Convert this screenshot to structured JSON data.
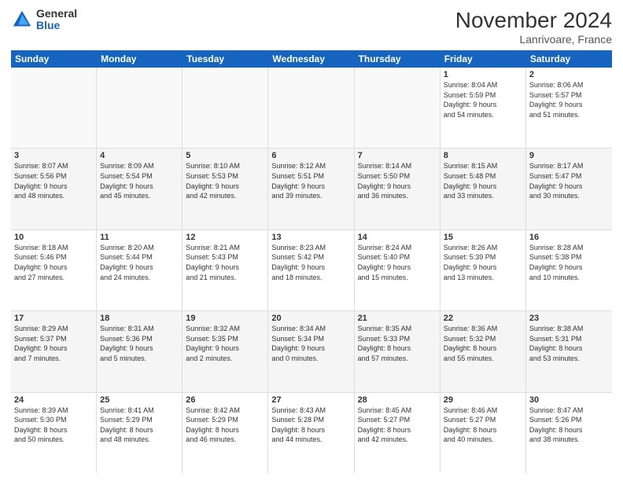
{
  "logo": {
    "general": "General",
    "blue": "Blue"
  },
  "title": "November 2024",
  "subtitle": "Lanrivoare, France",
  "header_days": [
    "Sunday",
    "Monday",
    "Tuesday",
    "Wednesday",
    "Thursday",
    "Friday",
    "Saturday"
  ],
  "weeks": [
    [
      {
        "day": "",
        "info": "",
        "empty": true
      },
      {
        "day": "",
        "info": "",
        "empty": true
      },
      {
        "day": "",
        "info": "",
        "empty": true
      },
      {
        "day": "",
        "info": "",
        "empty": true
      },
      {
        "day": "",
        "info": "",
        "empty": true
      },
      {
        "day": "1",
        "info": "Sunrise: 8:04 AM\nSunset: 5:59 PM\nDaylight: 9 hours\nand 54 minutes.",
        "empty": false
      },
      {
        "day": "2",
        "info": "Sunrise: 8:06 AM\nSunset: 5:57 PM\nDaylight: 9 hours\nand 51 minutes.",
        "empty": false
      }
    ],
    [
      {
        "day": "3",
        "info": "Sunrise: 8:07 AM\nSunset: 5:56 PM\nDaylight: 9 hours\nand 48 minutes.",
        "empty": false
      },
      {
        "day": "4",
        "info": "Sunrise: 8:09 AM\nSunset: 5:54 PM\nDaylight: 9 hours\nand 45 minutes.",
        "empty": false
      },
      {
        "day": "5",
        "info": "Sunrise: 8:10 AM\nSunset: 5:53 PM\nDaylight: 9 hours\nand 42 minutes.",
        "empty": false
      },
      {
        "day": "6",
        "info": "Sunrise: 8:12 AM\nSunset: 5:51 PM\nDaylight: 9 hours\nand 39 minutes.",
        "empty": false
      },
      {
        "day": "7",
        "info": "Sunrise: 8:14 AM\nSunset: 5:50 PM\nDaylight: 9 hours\nand 36 minutes.",
        "empty": false
      },
      {
        "day": "8",
        "info": "Sunrise: 8:15 AM\nSunset: 5:48 PM\nDaylight: 9 hours\nand 33 minutes.",
        "empty": false
      },
      {
        "day": "9",
        "info": "Sunrise: 8:17 AM\nSunset: 5:47 PM\nDaylight: 9 hours\nand 30 minutes.",
        "empty": false
      }
    ],
    [
      {
        "day": "10",
        "info": "Sunrise: 8:18 AM\nSunset: 5:46 PM\nDaylight: 9 hours\nand 27 minutes.",
        "empty": false
      },
      {
        "day": "11",
        "info": "Sunrise: 8:20 AM\nSunset: 5:44 PM\nDaylight: 9 hours\nand 24 minutes.",
        "empty": false
      },
      {
        "day": "12",
        "info": "Sunrise: 8:21 AM\nSunset: 5:43 PM\nDaylight: 9 hours\nand 21 minutes.",
        "empty": false
      },
      {
        "day": "13",
        "info": "Sunrise: 8:23 AM\nSunset: 5:42 PM\nDaylight: 9 hours\nand 18 minutes.",
        "empty": false
      },
      {
        "day": "14",
        "info": "Sunrise: 8:24 AM\nSunset: 5:40 PM\nDaylight: 9 hours\nand 15 minutes.",
        "empty": false
      },
      {
        "day": "15",
        "info": "Sunrise: 8:26 AM\nSunset: 5:39 PM\nDaylight: 9 hours\nand 13 minutes.",
        "empty": false
      },
      {
        "day": "16",
        "info": "Sunrise: 8:28 AM\nSunset: 5:38 PM\nDaylight: 9 hours\nand 10 minutes.",
        "empty": false
      }
    ],
    [
      {
        "day": "17",
        "info": "Sunrise: 8:29 AM\nSunset: 5:37 PM\nDaylight: 9 hours\nand 7 minutes.",
        "empty": false
      },
      {
        "day": "18",
        "info": "Sunrise: 8:31 AM\nSunset: 5:36 PM\nDaylight: 9 hours\nand 5 minutes.",
        "empty": false
      },
      {
        "day": "19",
        "info": "Sunrise: 8:32 AM\nSunset: 5:35 PM\nDaylight: 9 hours\nand 2 minutes.",
        "empty": false
      },
      {
        "day": "20",
        "info": "Sunrise: 8:34 AM\nSunset: 5:34 PM\nDaylight: 9 hours\nand 0 minutes.",
        "empty": false
      },
      {
        "day": "21",
        "info": "Sunrise: 8:35 AM\nSunset: 5:33 PM\nDaylight: 8 hours\nand 57 minutes.",
        "empty": false
      },
      {
        "day": "22",
        "info": "Sunrise: 8:36 AM\nSunset: 5:32 PM\nDaylight: 8 hours\nand 55 minutes.",
        "empty": false
      },
      {
        "day": "23",
        "info": "Sunrise: 8:38 AM\nSunset: 5:31 PM\nDaylight: 8 hours\nand 53 minutes.",
        "empty": false
      }
    ],
    [
      {
        "day": "24",
        "info": "Sunrise: 8:39 AM\nSunset: 5:30 PM\nDaylight: 8 hours\nand 50 minutes.",
        "empty": false
      },
      {
        "day": "25",
        "info": "Sunrise: 8:41 AM\nSunset: 5:29 PM\nDaylight: 8 hours\nand 48 minutes.",
        "empty": false
      },
      {
        "day": "26",
        "info": "Sunrise: 8:42 AM\nSunset: 5:29 PM\nDaylight: 8 hours\nand 46 minutes.",
        "empty": false
      },
      {
        "day": "27",
        "info": "Sunrise: 8:43 AM\nSunset: 5:28 PM\nDaylight: 8 hours\nand 44 minutes.",
        "empty": false
      },
      {
        "day": "28",
        "info": "Sunrise: 8:45 AM\nSunset: 5:27 PM\nDaylight: 8 hours\nand 42 minutes.",
        "empty": false
      },
      {
        "day": "29",
        "info": "Sunrise: 8:46 AM\nSunset: 5:27 PM\nDaylight: 8 hours\nand 40 minutes.",
        "empty": false
      },
      {
        "day": "30",
        "info": "Sunrise: 8:47 AM\nSunset: 5:26 PM\nDaylight: 8 hours\nand 38 minutes.",
        "empty": false
      }
    ]
  ]
}
